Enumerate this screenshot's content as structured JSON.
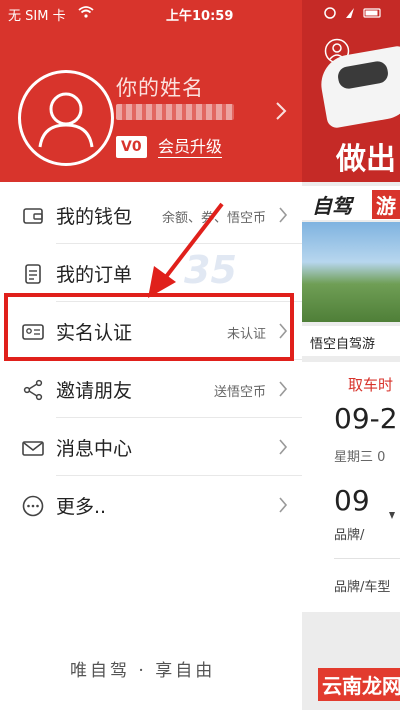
{
  "status_bar": {
    "carrier": "无 SIM 卡",
    "time": "上午10:59"
  },
  "drawer": {
    "user_name": "你的姓名",
    "vip_level": "V0",
    "vip_upgrade": "会员升级",
    "menu": [
      {
        "label": "我的钱包",
        "extra": "余额、券、悟空币",
        "icon": "wallet-icon"
      },
      {
        "label": "我的订单",
        "extra": "",
        "icon": "order-list-icon"
      },
      {
        "label": "实名认证",
        "extra": "未认证",
        "icon": "id-card-icon"
      },
      {
        "label": "邀请朋友",
        "extra": "送悟空币",
        "icon": "share-icon"
      },
      {
        "label": "消息中心",
        "extra": "",
        "icon": "mail-icon"
      },
      {
        "label": "更多..",
        "extra": "",
        "icon": "more-icon"
      }
    ],
    "slogan": "唯自驾 · 享自由"
  },
  "background_app": {
    "banner_text": "做出",
    "strip_left": "自驾",
    "strip_right": "游",
    "photo_caption": "悟空自驾游",
    "pickup_label": "取车时",
    "pickup_date": "09-2",
    "pickup_weekday": "星期三 0",
    "pickup_hour": "09",
    "brand_label_1": "品牌/",
    "brand_label_2": "品牌/车型"
  },
  "watermark": "35",
  "footer_badge": "云南龙网",
  "colors": {
    "brand_red": "#d8342c",
    "highlight_red": "#e0201b"
  }
}
